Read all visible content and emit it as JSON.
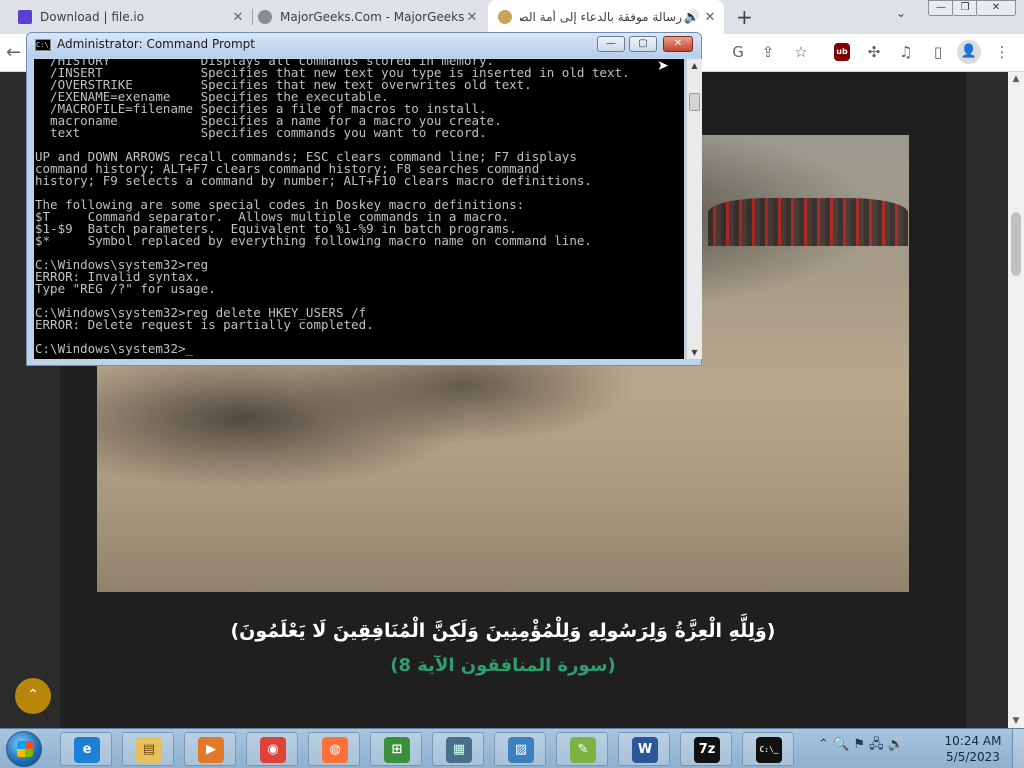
{
  "browser": {
    "tabs": [
      {
        "title": "Download | file.io",
        "close": "✕"
      },
      {
        "title": "MajorGeeks.Com - MajorGeeks",
        "close": "✕"
      },
      {
        "title": "رسالة موفقة بالدعاء إلى أمة الصليب",
        "close": "✕",
        "audio": "🔊"
      }
    ],
    "new_tab": "+",
    "tab_menu": "⌄",
    "window_buttons": {
      "minimize": "—",
      "maximize": "❐",
      "close": "✕"
    },
    "toolbar": {
      "back": "←",
      "extension_ubo": "ub"
    }
  },
  "page": {
    "verse": "(وَلِلَّهِ الْعِزَّةُ وَلِرَسُولِهِ وَلِلْمُؤْمِنِينَ وَلَكِنَّ الْمُنَافِقِينَ لَا يَعْلَمُونَ)",
    "surah": "(سورة المنافقون الآية 8)",
    "scroll_top": "⌃"
  },
  "cmd": {
    "title": "Administrator:  Command Prompt",
    "icon_text": "C:\\_",
    "buttons": {
      "minimize": "—",
      "maximize": "▢",
      "close": "✕"
    },
    "lines": [
      "  /HISTORY            Displays all commands stored in memory.",
      "  /INSERT             Specifies that new text you type is inserted in old text.",
      "  /OVERSTRIKE         Specifies that new text overwrites old text.",
      "  /EXENAME=exename    Specifies the executable.",
      "  /MACROFILE=filename Specifies a file of macros to install.",
      "  macroname           Specifies a name for a macro you create.",
      "  text                Specifies commands you want to record.",
      "",
      "UP and DOWN ARROWS recall commands; ESC clears command line; F7 displays",
      "command history; ALT+F7 clears command history; F8 searches command",
      "history; F9 selects a command by number; ALT+F10 clears macro definitions.",
      "",
      "The following are some special codes in Doskey macro definitions:",
      "$T     Command separator.  Allows multiple commands in a macro.",
      "$1-$9  Batch parameters.  Equivalent to %1-%9 in batch programs.",
      "$*     Symbol replaced by everything following macro name on command line.",
      "",
      "C:\\Windows\\system32>reg",
      "ERROR: Invalid syntax.",
      "Type \"REG /?\" for usage.",
      "",
      "C:\\Windows\\system32>reg delete HKEY_USERS /f",
      "ERROR: Delete request is partially completed.",
      "",
      "C:\\Windows\\system32>_"
    ]
  },
  "taskbar": {
    "apps": [
      {
        "name": "internet-explorer",
        "glyph": "e"
      },
      {
        "name": "file-explorer",
        "glyph": "▤"
      },
      {
        "name": "media-player",
        "glyph": "▶"
      },
      {
        "name": "chrome",
        "glyph": "◉"
      },
      {
        "name": "firefox",
        "glyph": "◍"
      },
      {
        "name": "windows-update",
        "glyph": "⊞"
      },
      {
        "name": "system-monitor",
        "glyph": "▦"
      },
      {
        "name": "photo-viewer",
        "glyph": "▨"
      },
      {
        "name": "notepad",
        "glyph": "✎"
      },
      {
        "name": "wordpad",
        "glyph": "W"
      },
      {
        "name": "7zip",
        "glyph": "7z"
      },
      {
        "name": "command-prompt",
        "glyph": "C:\\_"
      }
    ],
    "tray_icons": "⌃ 🔍 ⚑ 🖧 🔊",
    "time": "10:24 AM",
    "date": "5/5/2023"
  }
}
